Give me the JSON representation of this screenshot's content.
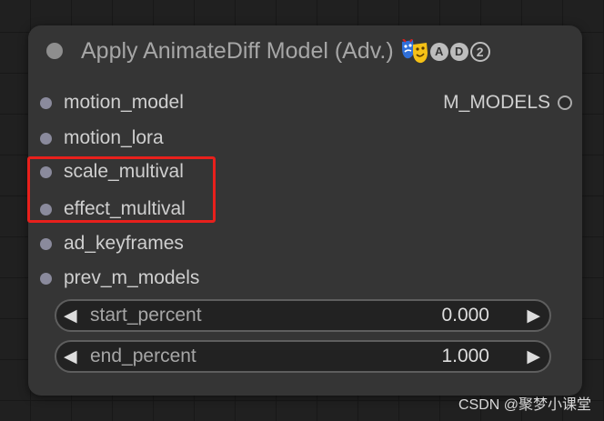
{
  "node": {
    "title": "Apply AnimateDiff Model (Adv.)",
    "title_emoji_icon": "theater-masks-icon",
    "badges": [
      "A",
      "D",
      "2"
    ],
    "inputs": [
      {
        "label": "motion_model"
      },
      {
        "label": "motion_lora"
      },
      {
        "label": "scale_multival"
      },
      {
        "label": "effect_multival"
      },
      {
        "label": "ad_keyframes"
      },
      {
        "label": "prev_m_models"
      }
    ],
    "output": {
      "label": "M_MODELS"
    },
    "widgets": [
      {
        "label": "start_percent",
        "value": "0.000",
        "left_arrow": "◀",
        "right_arrow": "▶"
      },
      {
        "label": "end_percent",
        "value": "1.000",
        "left_arrow": "◀",
        "right_arrow": "▶"
      }
    ]
  },
  "watermark": "CSDN @聚梦小课堂",
  "colors": {
    "canvas": "#202020",
    "node_body": "#353535",
    "slot_dot": "#8a8a9c",
    "highlight": "#e8201c"
  }
}
